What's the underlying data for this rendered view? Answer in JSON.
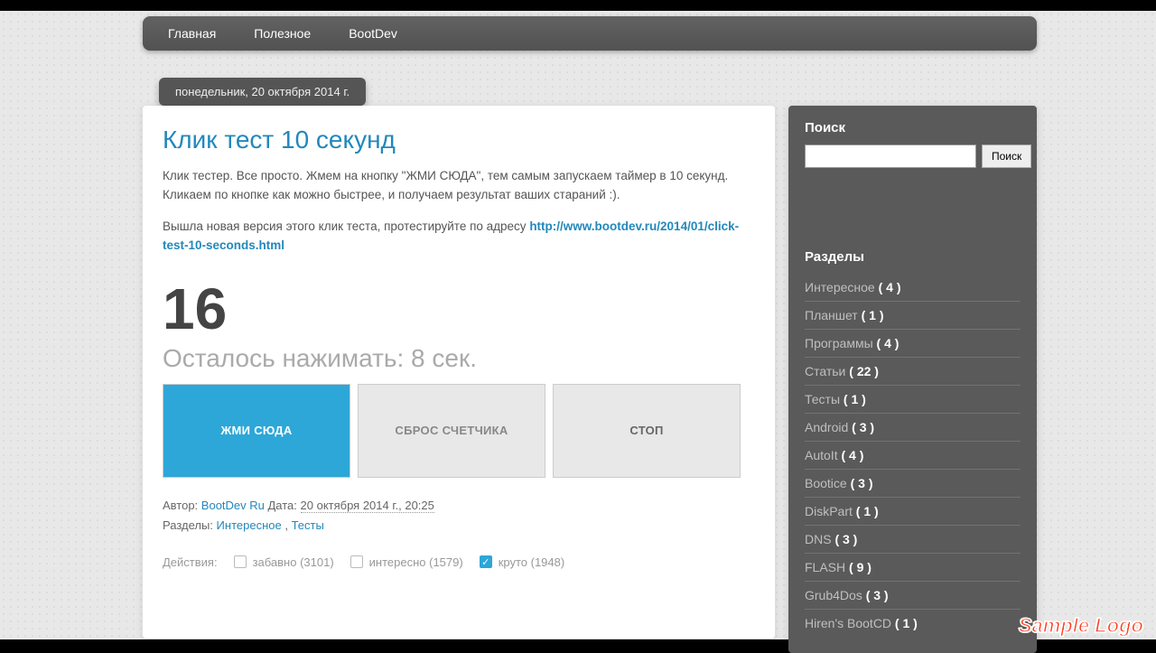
{
  "nav": {
    "items": [
      "Главная",
      "Полезное",
      "BootDev"
    ]
  },
  "date_pill": "понедельник, 20 октября 2014 г.",
  "post": {
    "title": "Клик тест 10 секунд",
    "p1": "Клик тестер. Все просто. Жмем на кнопку \"ЖМИ СЮДА\", тем самым запускаем таймер в 10 секунд. Кликаем по кнопке как можно быстрее, и получаем результат ваших стараний :).",
    "p2_pre": "Вышла новая версия этого клик теста, протестируйте по адресу ",
    "p2_link": "http://www.bootdev.ru/2014/01/click-test-10-seconds.html",
    "counter": "16",
    "remaining": "Осталось нажимать: 8 сек.",
    "btn_click": "ЖМИ СЮДА",
    "btn_reset": "СБРОС СЧЕТЧИКА",
    "btn_stop": "СТОП"
  },
  "meta": {
    "author_label": "Автор: ",
    "author": "BootDev Ru",
    "date_label": " Дата: ",
    "date": "20 октября 2014 г., 20:25",
    "sections_label": "Разделы: ",
    "tag1": "Интересное",
    "sep": " , ",
    "tag2": "Тесты"
  },
  "reactions": {
    "label": "Действия:",
    "items": [
      {
        "text": "забавно (3101)",
        "checked": false
      },
      {
        "text": "интересно (1579)",
        "checked": false
      },
      {
        "text": "круто (1948)",
        "checked": true
      }
    ]
  },
  "sidebar": {
    "search_heading": "Поиск",
    "search_btn": "Поиск",
    "sections_heading": "Разделы",
    "categories": [
      {
        "name": "Интересное",
        "count": "( 4 )"
      },
      {
        "name": "Планшет",
        "count": "( 1 )"
      },
      {
        "name": "Программы",
        "count": "( 4 )"
      },
      {
        "name": "Статьи",
        "count": "( 22 )"
      },
      {
        "name": "Тесты",
        "count": "( 1 )"
      },
      {
        "name": "Android",
        "count": "( 3 )"
      },
      {
        "name": "AutoIt",
        "count": "( 4 )"
      },
      {
        "name": "Bootice",
        "count": "( 3 )"
      },
      {
        "name": "DiskPart",
        "count": "( 1 )"
      },
      {
        "name": "DNS",
        "count": "( 3 )"
      },
      {
        "name": "FLASH",
        "count": "( 9 )"
      },
      {
        "name": "Grub4Dos",
        "count": "( 3 )"
      },
      {
        "name": "Hiren's BootCD",
        "count": "( 1 )"
      }
    ]
  },
  "watermark": "Sample Logo"
}
